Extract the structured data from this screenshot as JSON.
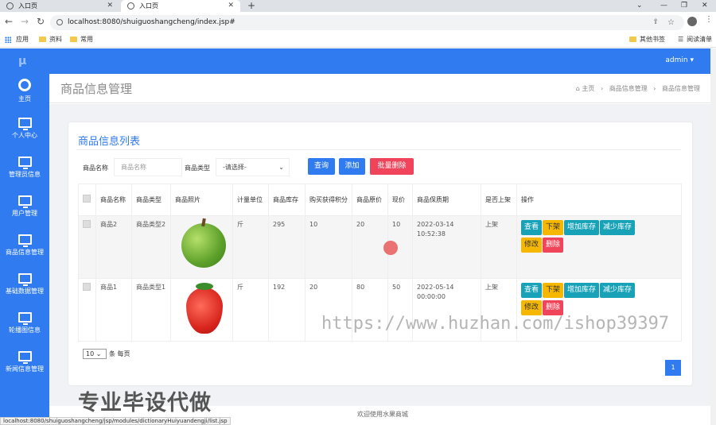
{
  "browser": {
    "tabs": [
      {
        "label": "入口页"
      },
      {
        "label": "入口页"
      }
    ],
    "url": "localhost:8080/shuiguoshangcheng/index.jsp#",
    "bookmarks": {
      "apps": "应用",
      "b1": "资料",
      "b2": "常用",
      "other": "其他书签",
      "reading": "阅读清单"
    },
    "status_url": "localhost:8080/shuiguoshangcheng/jsp/modules/dictionaryHuiyuandengji/list.jsp"
  },
  "sidebar": {
    "items": [
      {
        "label": "主页",
        "icon": "dashboard-icon"
      },
      {
        "label": "个人中心",
        "icon": "monitor-icon"
      },
      {
        "label": "管理员信息",
        "icon": "monitor-icon"
      },
      {
        "label": "用户管理",
        "icon": "monitor-icon"
      },
      {
        "label": "商品信息管理",
        "icon": "monitor-icon"
      },
      {
        "label": "基础数据管理",
        "icon": "monitor-icon"
      },
      {
        "label": "轮播图信息",
        "icon": "monitor-icon"
      },
      {
        "label": "新闻信息管理",
        "icon": "monitor-icon"
      }
    ]
  },
  "topbar": {
    "user": "admin ▾"
  },
  "header": {
    "title": "商品信息管理",
    "crumbs": [
      "主页",
      "商品信息管理",
      "商品信息管理"
    ]
  },
  "card": {
    "title": "商品信息列表",
    "filter": {
      "name_label": "商品名称",
      "name_placeholder": "商品名称",
      "type_label": "商品类型",
      "type_value": "-请选择-"
    },
    "buttons": {
      "query": "查询",
      "add": "添加",
      "batch_delete": "批量删除"
    },
    "columns": [
      "商品名称",
      "商品类型",
      "商品照片",
      "计量单位",
      "商品库存",
      "购买获得积分",
      "商品原价",
      "现价",
      "商品保质期",
      "是否上架",
      "操作"
    ],
    "rows": [
      {
        "name": "商品2",
        "type": "商品类型2",
        "photo": "apple",
        "unit": "斤",
        "stock": "295",
        "points": "10",
        "original": "20",
        "price": "10",
        "expiry": "2022-03-14 10:52:38",
        "listed": "上架"
      },
      {
        "name": "商品1",
        "type": "商品类型1",
        "photo": "strawberry",
        "unit": "斤",
        "stock": "192",
        "points": "20",
        "original": "80",
        "price": "50",
        "expiry": "2022-05-14 00:00:00",
        "listed": "上架"
      }
    ],
    "actions": {
      "view": "查看",
      "off": "下架",
      "add_stock": "增加库存",
      "reduce_stock": "减少库存",
      "edit": "修改",
      "delete": "删除"
    },
    "pager": {
      "size": "10",
      "suffix": "条 每页",
      "page": "1"
    }
  },
  "footer": "欢迎使用水果商城",
  "overlay": {
    "watermark": "https://www.huzhan.com/ishop39397",
    "promo": "专业毕设代做"
  },
  "colors": {
    "primary": "#2f7bef",
    "warning": "#f5b700",
    "teal": "#17a2b8",
    "danger": "#f0445a"
  }
}
